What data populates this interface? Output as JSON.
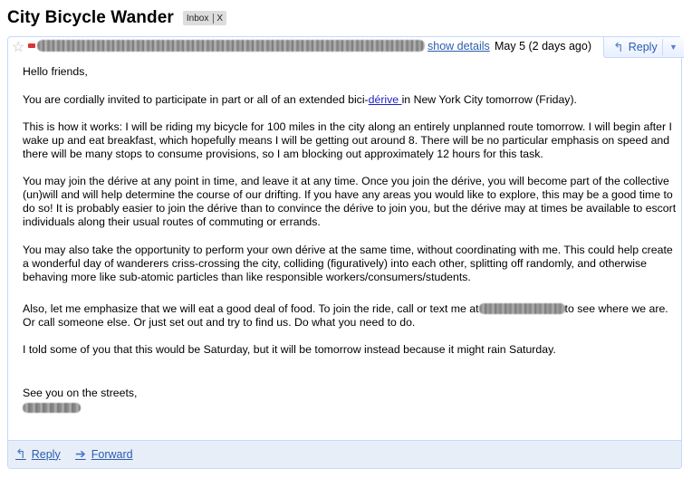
{
  "subject": "City Bicycle Wander",
  "label": {
    "name": "Inbox",
    "close": "X"
  },
  "header": {
    "show_details": "show details",
    "date": "May 5 (2 days ago)",
    "reply": "Reply",
    "more_arrow": "▼"
  },
  "body": {
    "greeting": "Hello friends,",
    "p1_before": "You are cordially invited to participate in part or all of an extended bici-",
    "p1_link": "dérive ",
    "p1_after": "in New York City tomorrow (Friday).",
    "p2": "This is how it works: I will be riding my bicycle for 100 miles in the city along an entirely unplanned route tomorrow. I will begin after I wake up and eat breakfast, which hopefully means I will be getting out around 8. There will be no particular emphasis on speed and there will be many stops to consume provisions, so I am blocking out approximately 12 hours for this task.",
    "p3": "You may join the dérive at any point in time, and leave it at any time. Once you join the dérive, you will become part of the collective (un)will and will help determine the course of our drifting. If you have any areas you would like to explore, this may be a good time to do so! It is probably easier to join the dérive than to convince the dérive to join you, but the dérive may at times be available to escort individuals along their usual routes of commuting or errands.",
    "p4": "You may also take the opportunity to perform your own dérive at the same time, without coordinating with me. This could help create a wonderful day of wanderers criss-crossing the city, colliding (figuratively) into each other, splitting off randomly, and otherwise behaving more like sub-atomic particles than like responsible workers/consumers/students.",
    "p5_before": "Also, let me emphasize that we will eat a good deal of food. To join the ride, call or text me at",
    "p5_after": "to see where we are. Or call someone else. Or just set out and try to find us. Do what you need to do.",
    "p6": "I told some of you that this would be Saturday, but it will be tomorrow instead because it might rain Saturday.",
    "closing": "See you on the streets,"
  },
  "footer": {
    "reply": "Reply",
    "forward": "Forward"
  }
}
